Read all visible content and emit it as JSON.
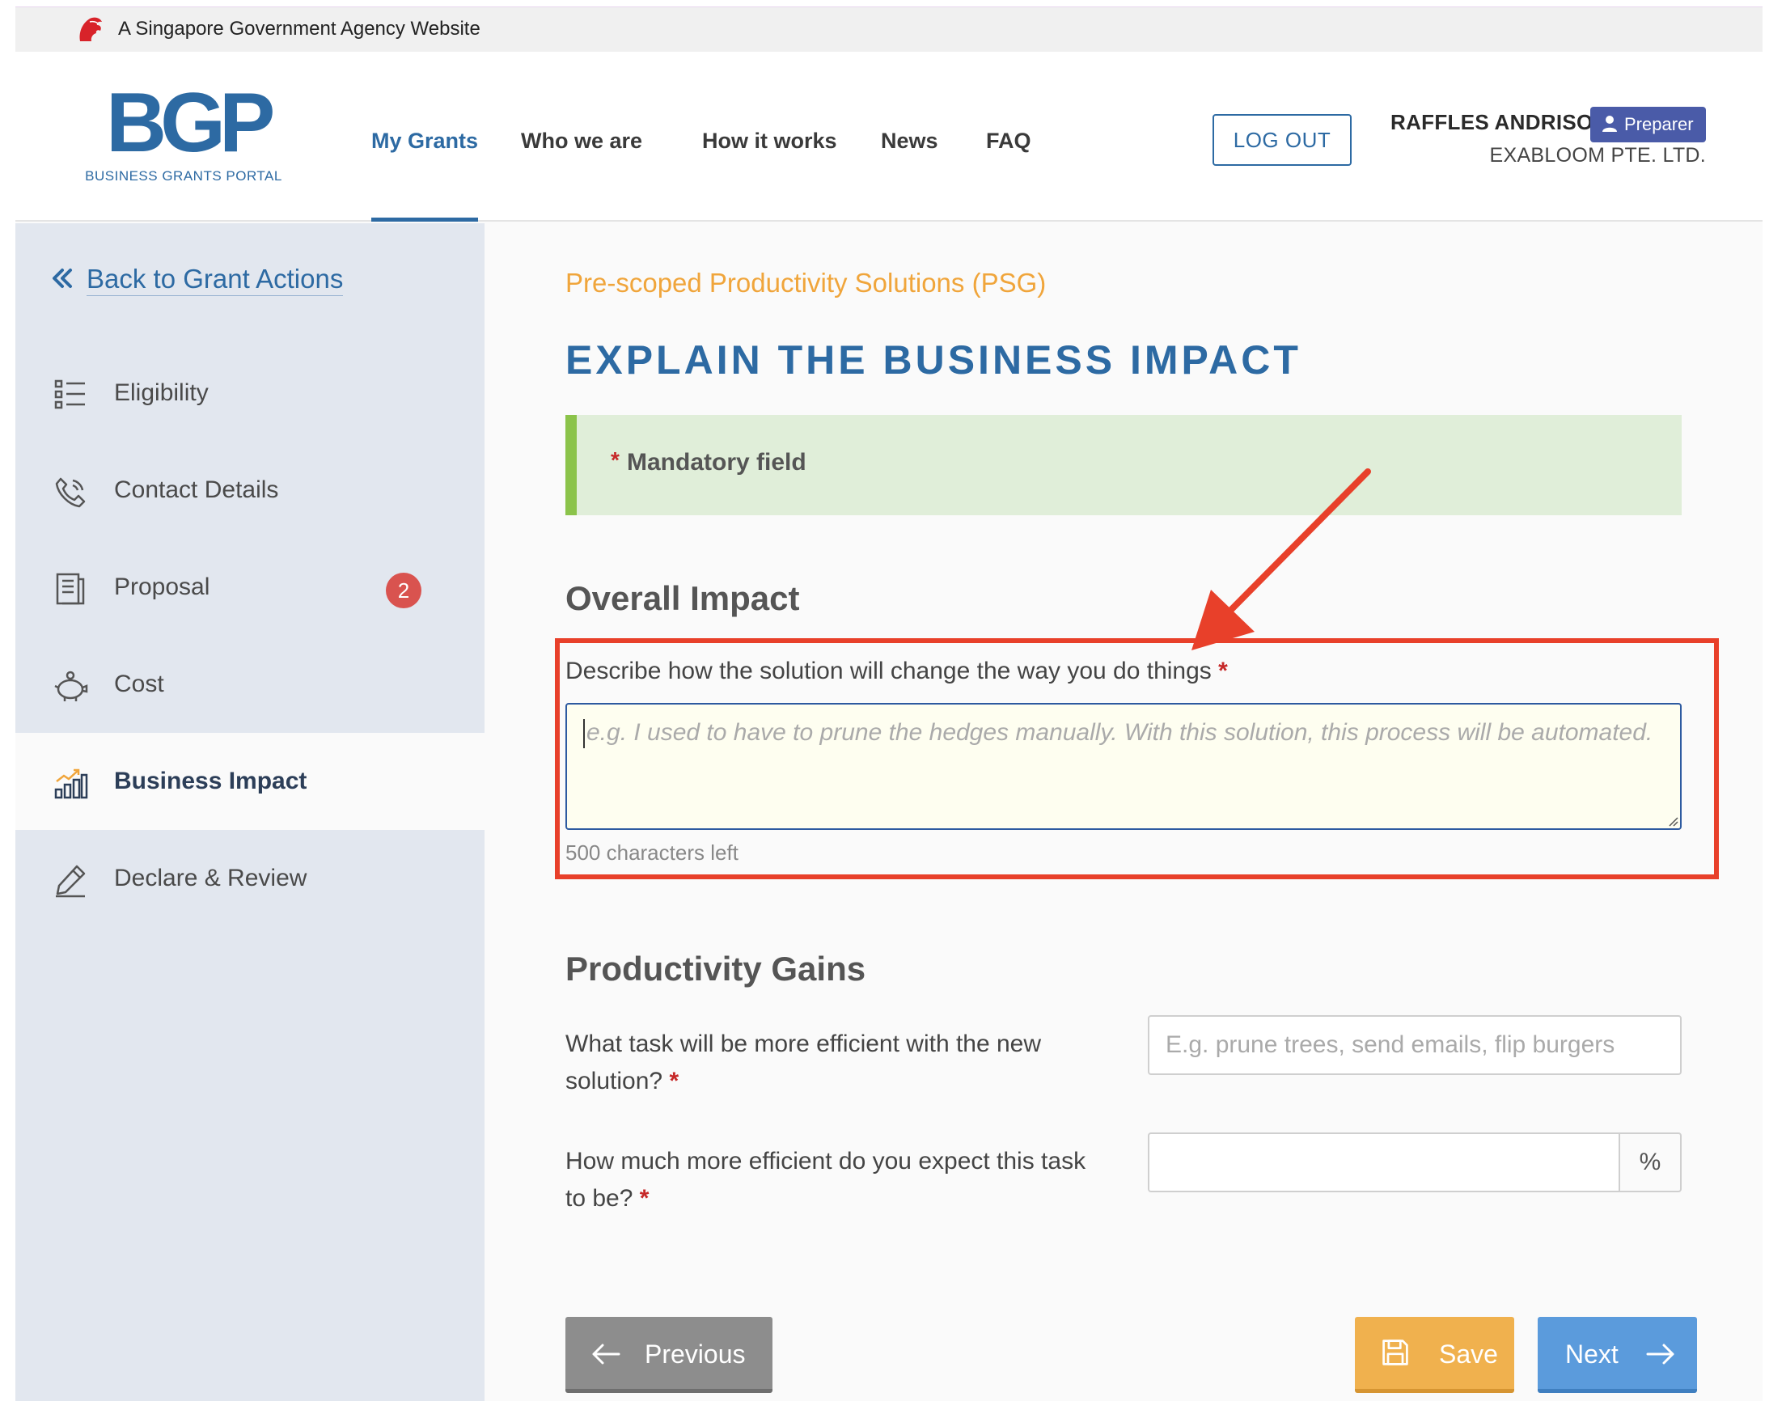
{
  "gov_banner": {
    "text": "A Singapore Government Agency Website",
    "icon": "lion-head-icon"
  },
  "header": {
    "logo_mark": "BGP",
    "logo_sub": "BUSINESS GRANTS PORTAL",
    "nav": [
      {
        "label": "My Grants",
        "active": true
      },
      {
        "label": "Who we are"
      },
      {
        "label": "How it works"
      },
      {
        "label": "News"
      },
      {
        "label": "FAQ"
      }
    ],
    "logout_label": "LOG OUT",
    "user_name": "RAFFLES ANDRISON",
    "role": "Preparer",
    "company": "EXABLOOM PTE. LTD."
  },
  "sidebar": {
    "back_label": "Back to Grant Actions",
    "items": [
      {
        "label": "Eligibility",
        "icon": "checklist-icon"
      },
      {
        "label": "Contact Details",
        "icon": "phone-icon"
      },
      {
        "label": "Proposal",
        "icon": "document-icon",
        "badge": "2"
      },
      {
        "label": "Cost",
        "icon": "piggy-bank-icon"
      },
      {
        "label": "Business Impact",
        "icon": "bar-chart-icon",
        "active": true
      },
      {
        "label": "Declare & Review",
        "icon": "pen-icon"
      }
    ]
  },
  "main": {
    "scheme": "Pre-scoped Productivity Solutions (PSG)",
    "title": "EXPLAIN THE BUSINESS IMPACT",
    "notice": "Mandatory field",
    "overall": {
      "heading": "Overall Impact",
      "question": "Describe how the solution will change the way you do things",
      "placeholder": "e.g. I used to have to prune the hedges manually. With this solution, this process will be automated.",
      "chars_left": "500 characters left"
    },
    "gains": {
      "heading": "Productivity Gains",
      "q1": "What task will be more efficient with the new solution?",
      "q1_placeholder": "E.g. prune trees, send emails, flip burgers",
      "q2": "How much more efficient do you expect this task to be?",
      "q2_unit": "%"
    },
    "buttons": {
      "previous": "Previous",
      "save": "Save",
      "next": "Next"
    }
  },
  "colors": {
    "brand_blue": "#2d6aa3",
    "scheme_orange": "#f0a53b",
    "annotation_red": "#e8402a",
    "save_orange": "#f0b14e",
    "next_blue": "#5b9bdc"
  }
}
